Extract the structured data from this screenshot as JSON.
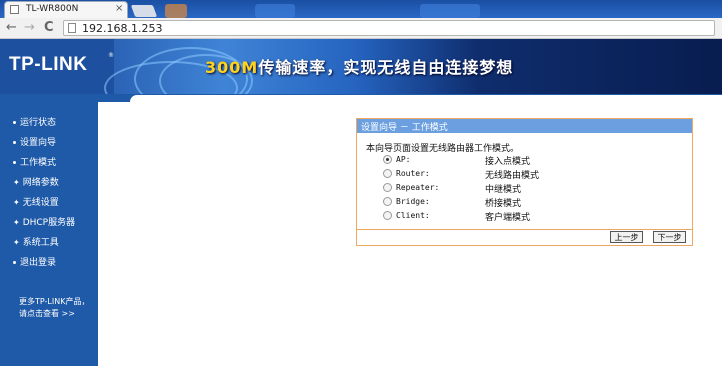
{
  "browser": {
    "tab_title": "TL-WR800N",
    "tab_close": "×",
    "url": "192.168.1.253",
    "back": "←",
    "forward": "→",
    "reload": "C"
  },
  "banner": {
    "logo": "TP-LINK",
    "logo_reg": "®",
    "slogan_num": "300M",
    "slogan_text": "传输速率，实现无线自由连接梦想"
  },
  "sidebar": {
    "items": [
      {
        "label": "运行状态"
      },
      {
        "label": "设置向导"
      },
      {
        "label": "工作模式"
      },
      {
        "label": "网络参数"
      },
      {
        "label": "无线设置"
      },
      {
        "label": "DHCP服务器"
      },
      {
        "label": "系统工具"
      },
      {
        "label": "退出登录"
      }
    ],
    "more_line1": "更多TP-LINK产品，",
    "more_line2": "请点击查看 >>"
  },
  "panel": {
    "title": "设置向导 － 工作模式",
    "description": "本向导页面设置无线路由器工作模式。",
    "options": [
      {
        "key": "AP:",
        "label": "接入点模式",
        "selected": true
      },
      {
        "key": "Router:",
        "label": "无线路由模式",
        "selected": false
      },
      {
        "key": "Repeater:",
        "label": "中继模式",
        "selected": false
      },
      {
        "key": "Bridge:",
        "label": "桥接模式",
        "selected": false
      },
      {
        "key": "Client:",
        "label": "客户端模式",
        "selected": false
      }
    ],
    "prev_button": "上一步",
    "next_button": "下一步"
  },
  "colors": {
    "nav_blue": "#1f5aa8",
    "panel_header": "#6b9fe0",
    "panel_border": "#f0a860",
    "slogan_accent": "#ffd21e"
  }
}
